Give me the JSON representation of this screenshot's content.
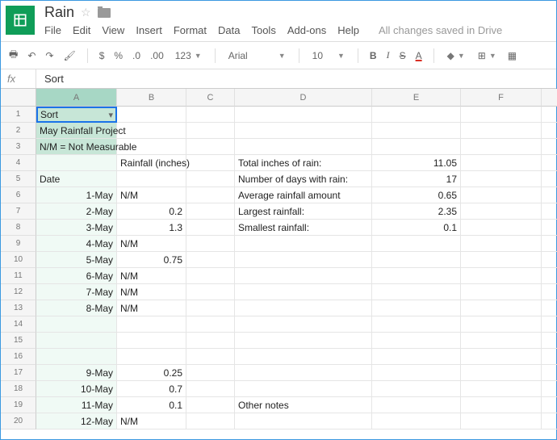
{
  "doc": {
    "title": "Rain",
    "save_msg": "All changes saved in Drive"
  },
  "menu": {
    "file": "File",
    "edit": "Edit",
    "view": "View",
    "insert": "Insert",
    "format": "Format",
    "data": "Data",
    "tools": "Tools",
    "addons": "Add-ons",
    "help": "Help"
  },
  "toolbar": {
    "dollar": "$",
    "percent": "%",
    "dec_dec": ".0",
    "dec_inc": ".00",
    "fmt": "123",
    "font": "Arial",
    "size": "10",
    "bold": "B",
    "italic": "I",
    "strike": "S",
    "textcolor": "A"
  },
  "fx": {
    "label": "fx",
    "value": "Sort"
  },
  "cols": {
    "A": "A",
    "B": "B",
    "C": "C",
    "D": "D",
    "E": "E",
    "F": "F"
  },
  "rows": {
    "r1": "1",
    "r2": "2",
    "r3": "3",
    "r4": "4",
    "r5": "5",
    "r6": "6",
    "r7": "7",
    "r8": "8",
    "r9": "9",
    "r10": "10",
    "r11": "11",
    "r12": "12",
    "r13": "13",
    "r14": "14",
    "r15": "15",
    "r16": "16",
    "r17": "17",
    "r18": "18",
    "r19": "19",
    "r20": "20"
  },
  "cells": {
    "A1": "Sort",
    "A2": "May Rainfall Project",
    "A3": "N/M = Not Measurable",
    "B4": "Rainfall (inches)",
    "A5": "Date",
    "A6": "1-May",
    "B6": "N/M",
    "A7": "2-May",
    "B7": "0.2",
    "A8": "3-May",
    "B8": "1.3",
    "A9": "4-May",
    "B9": "N/M",
    "A10": "5-May",
    "B10": "0.75",
    "A11": "6-May",
    "B11": "N/M",
    "A12": "7-May",
    "B12": "N/M",
    "A13": "8-May",
    "B13": "N/M",
    "A17": "9-May",
    "B17": "0.25",
    "A18": "10-May",
    "B18": "0.7",
    "A19": "11-May",
    "B19": "0.1",
    "A20": "12-May",
    "B20": "N/M",
    "D4": "Total inches of rain:",
    "E4": "11.05",
    "D5": "Number of days with rain:",
    "E5": "17",
    "D6": "Average rainfall amount",
    "E6": "0.65",
    "D7": "Largest rainfall:",
    "E7": "2.35",
    "D8": "Smallest rainfall:",
    "E8": "0.1",
    "D19": "Other notes"
  }
}
